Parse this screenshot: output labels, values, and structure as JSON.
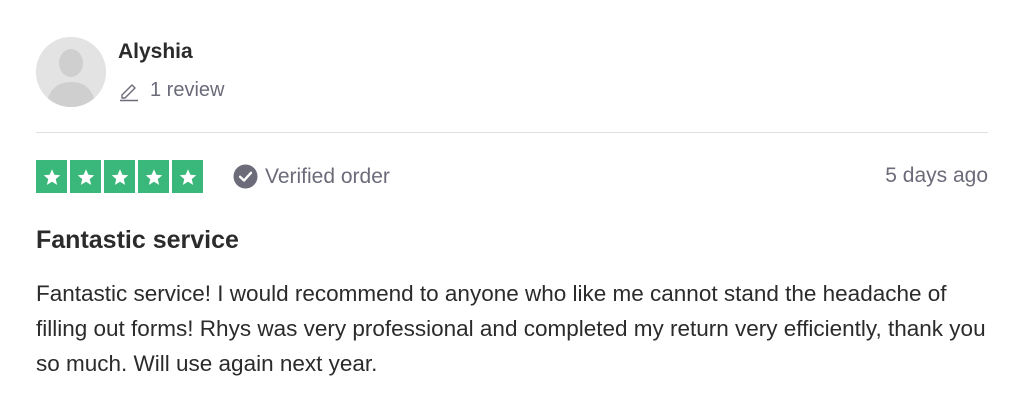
{
  "consumer": {
    "name": "Alyshia",
    "review_count": "1 review"
  },
  "review": {
    "rating": 5,
    "rating_max": 5,
    "star_color": "#3ab77a",
    "verified_label": "Verified order",
    "date": "5 days ago",
    "title": "Fantastic service",
    "body": "Fantastic service! I would recommend to anyone who like me cannot stand the headache of filling out forms! Rhys was very professional and completed my return very efficiently, thank you so much. Will use again next year."
  },
  "icons": {
    "avatar": "user-silhouette-icon",
    "review_count": "pencil-icon",
    "verified": "check-circle-icon",
    "star": "star-icon"
  }
}
